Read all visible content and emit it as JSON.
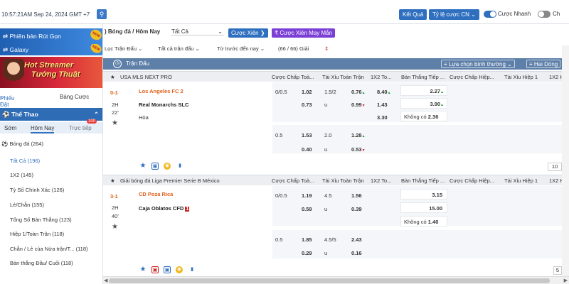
{
  "topbar": {
    "datetime": "10:57:21AM Sep 24, 2024 GMT +7",
    "result_btn": "Kết Quả",
    "odds_btn": "Tỷ lệ cược CN",
    "quick_bet_label": "Cược Nhanh",
    "last_label": "Ch"
  },
  "sidebar": {
    "withdraw_banner": "Phiên bản Rút Gọn",
    "galaxy_banner": "Galaxy",
    "hot_line1": "Hot Streamer",
    "hot_line2": "Tướng Thuật",
    "new_badge": "NEW",
    "tab_slip": "Phiếu Đặt Cược",
    "tab_table": "Bảng Cược",
    "sports_title": "Thể Thao",
    "period_early": "Sớm",
    "period_today": "Hôm Nay",
    "period_live": "Trực tiếp",
    "live_count": "100",
    "football_label": "Bóng đá (264)",
    "items": [
      {
        "label": "Tất Cả (196)"
      },
      {
        "label": "1X2 (145)"
      },
      {
        "label": "Tỷ Số Chính Xác (126)"
      },
      {
        "label": "Lẻ/Chẵn (155)"
      },
      {
        "label": "Tổng Số Bàn Thắng (123)"
      },
      {
        "label": "Hiệp 1/Toàn Trận (118)"
      },
      {
        "label": "Chẵn / Lẻ của Nửa trận/T... (118)"
      },
      {
        "label": "Bàn thắng Đầu/ Cuối (118)"
      }
    ]
  },
  "main": {
    "breadcrumb": "Bóng đá / Hôm Nay",
    "select_all": "Tất Cả",
    "btn_xien": "Cược Xiên",
    "btn_lucky": "Cược Xiên May Mắn",
    "filter_match": "Lọc Trận Đấu",
    "filter_all_matches": "Tất cả trận đấu",
    "filter_time": "Từ trước đến nay",
    "filter_count": "(66 / 66) Giải",
    "header_label": "Trận Đấu",
    "header_choice": "Lựa chọn bình thường",
    "header_two": "Hai Dòng",
    "columns": [
      "Cược Chấp Toà...",
      "Tài Xỉu Toàn Trận",
      "1X2 To...",
      "Bàn Thắng Tiếp ...",
      "Cược Chấp Hiệp...",
      "Tài Xỉu Hiệp 1",
      "1X2 H"
    ],
    "leagues": [
      {
        "name": "USA MLS NEXT PRO",
        "score": "0-1",
        "half": "2H",
        "minute": "22'",
        "home": "Los Angeles FC 2",
        "away": "Real Monarchs SLC",
        "draw": "Hòa",
        "red_card": "",
        "rows": [
          {
            "hcap": "0/0.5",
            "hcap_odds": "1.02",
            "ou": "1.5/2",
            "ou_odds": "0.76",
            "ou_dir": "up",
            "x12": "8.40",
            "x12_dir": "up",
            "next": "2.27",
            "next_dir": "up"
          },
          {
            "hcap": "",
            "hcap_odds": "0.73",
            "ou": "u",
            "ou_odds": "0.99",
            "ou_dir": "dn",
            "x12": "1.43",
            "x12_dir": "",
            "next": "3.90",
            "next_dir": "up"
          },
          {
            "hcap": "",
            "hcap_odds": "",
            "ou": "",
            "ou_odds": "",
            "ou_dir": "",
            "x12": "3.30",
            "x12_dir": "",
            "next": "Không có",
            "next_val": "2.36"
          }
        ],
        "sub_rows": [
          {
            "hcap": "0.5",
            "hcap_odds": "1.53",
            "ou": "2.0",
            "ou_odds": "1.28",
            "ou_dir": "up"
          },
          {
            "hcap": "",
            "hcap_odds": "0.40",
            "ou": "u",
            "ou_odds": "0.53",
            "ou_dir": "dn"
          }
        ],
        "more": "10"
      },
      {
        "name": "Giải bóng đá Liga Premier Serie B México",
        "score": "3-1",
        "half": "2H",
        "minute": "40'",
        "home": "CD Poza Rica",
        "away": "Caja Oblatos CFD",
        "draw": "",
        "red_card": "1",
        "rows": [
          {
            "hcap": "0/0.5",
            "hcap_odds": "1.19",
            "ou": "4.5",
            "ou_odds": "1.56",
            "ou_dir": "",
            "x12": "",
            "x12_dir": "",
            "next": "3.15",
            "next_dir": ""
          },
          {
            "hcap": "",
            "hcap_odds": "0.59",
            "ou": "u",
            "ou_odds": "0.39",
            "ou_dir": "",
            "x12": "",
            "x12_dir": "",
            "next": "15.00",
            "next_dir": ""
          },
          {
            "hcap": "",
            "hcap_odds": "",
            "ou": "",
            "ou_odds": "",
            "ou_dir": "",
            "x12": "",
            "x12_dir": "",
            "next": "Không có",
            "next_val": "1.40"
          }
        ],
        "sub_rows": [
          {
            "hcap": "0.5",
            "hcap_odds": "1.85",
            "ou": "4.5/5",
            "ou_odds": "2.43",
            "ou_dir": ""
          },
          {
            "hcap": "",
            "hcap_odds": "0.29",
            "ou": "u",
            "ou_odds": "0.16",
            "ou_dir": ""
          }
        ],
        "more": "5"
      }
    ]
  },
  "colors": {
    "primary": "#2f6fbf",
    "header": "#5d7fa8",
    "team_home": "#e0601a",
    "purple": "#7b3fd6"
  }
}
